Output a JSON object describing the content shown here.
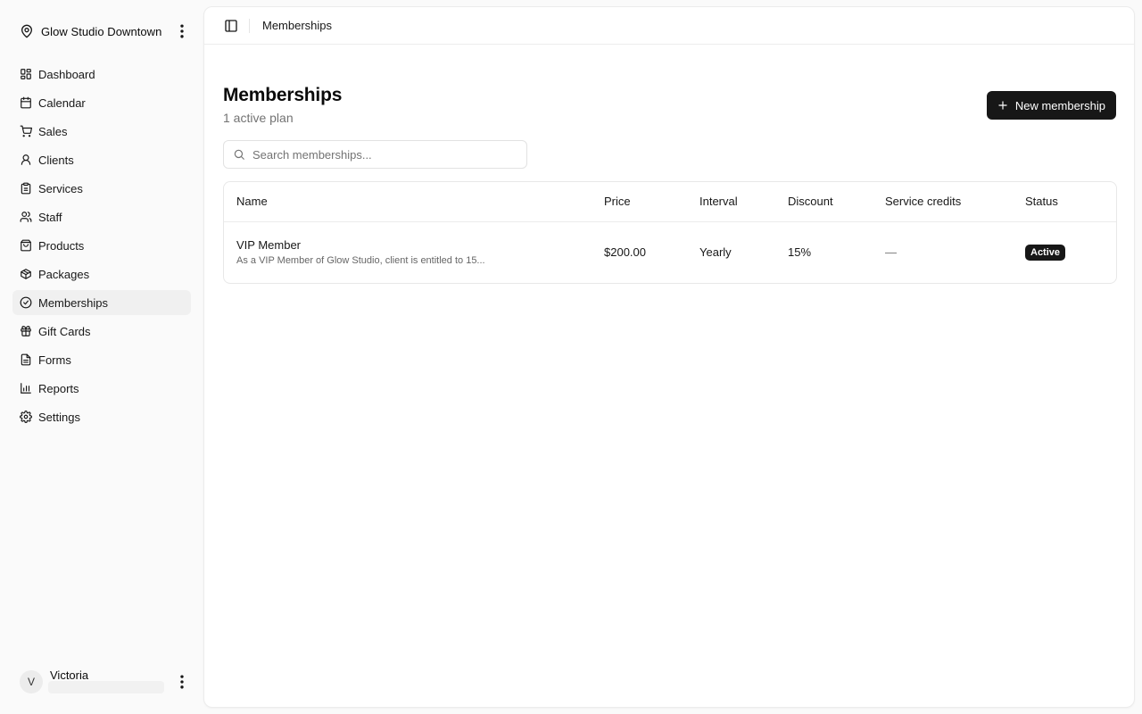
{
  "sidebar": {
    "org_name": "Glow Studio Downtown",
    "org_icon": "map-pin-icon",
    "items": [
      {
        "label": "Dashboard",
        "icon": "dashboard-icon"
      },
      {
        "label": "Calendar",
        "icon": "calendar-icon"
      },
      {
        "label": "Sales",
        "icon": "cart-icon"
      },
      {
        "label": "Clients",
        "icon": "user-icon"
      },
      {
        "label": "Services",
        "icon": "clipboard-icon"
      },
      {
        "label": "Staff",
        "icon": "users-icon"
      },
      {
        "label": "Products",
        "icon": "shopping-bag-icon"
      },
      {
        "label": "Packages",
        "icon": "package-icon"
      },
      {
        "label": "Memberships",
        "icon": "badge-check-icon",
        "active": true
      },
      {
        "label": "Gift Cards",
        "icon": "gift-icon"
      },
      {
        "label": "Forms",
        "icon": "file-text-icon"
      },
      {
        "label": "Reports",
        "icon": "bar-chart-icon"
      },
      {
        "label": "Settings",
        "icon": "gear-icon"
      }
    ],
    "user": {
      "initial": "V",
      "name": "Victoria"
    }
  },
  "topbar": {
    "breadcrumb": "Memberships"
  },
  "page": {
    "title": "Memberships",
    "subtitle": "1 active plan",
    "new_button": "New membership"
  },
  "search": {
    "placeholder": "Search memberships...",
    "value": ""
  },
  "table": {
    "columns": [
      "Name",
      "Price",
      "Interval",
      "Discount",
      "Service credits",
      "Status"
    ],
    "rows": [
      {
        "name": "VIP Member",
        "description": "As a VIP Member of Glow Studio, client is entitled to 15...",
        "price": "$200.00",
        "interval": "Yearly",
        "discount": "15%",
        "service_credits": "—",
        "status": "Active"
      }
    ]
  },
  "colors": {
    "accent": "#171717",
    "background": "#fafafa",
    "active_nav": "#f0f0f0",
    "muted_text": "#737373"
  }
}
